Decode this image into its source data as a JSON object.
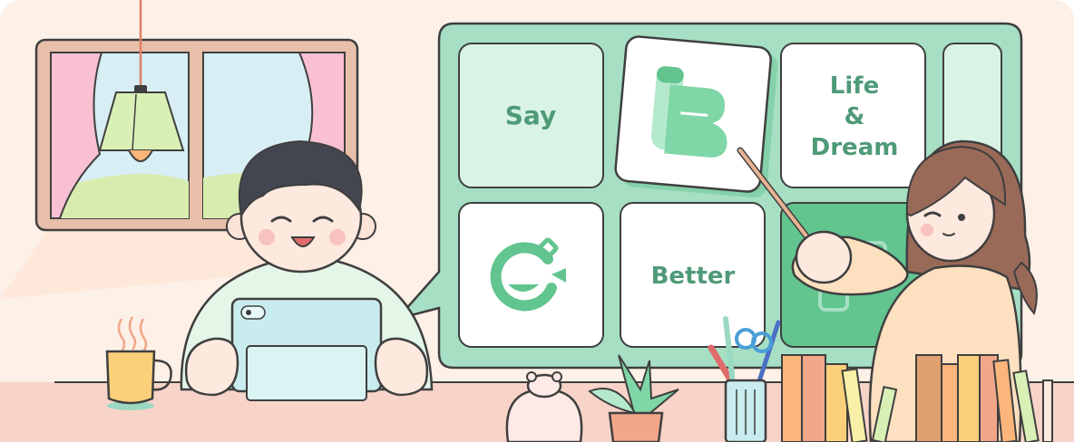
{
  "board": {
    "tile_say": "Say",
    "tile_life": "Life",
    "tile_amp": "&",
    "tile_dream": "Dream",
    "tile_better": "Better"
  },
  "colors": {
    "background": "#fdf0e6",
    "board": "#a6dfc4",
    "board_border": "#3f3f3f",
    "tile_light": "#d9f4e5",
    "tile_white": "#ffffff",
    "tile_dark": "#62c48f",
    "text_green": "#4f9a78",
    "desk": "#f8d4c8"
  },
  "icons": [
    "lamp-icon",
    "window-icon",
    "tea-mug-icon",
    "tablet-icon",
    "brand-b-logo-icon",
    "brand-c-logo-icon",
    "plant-icon",
    "pencil-cup-icon",
    "books-icon",
    "toy-bear-icon"
  ]
}
